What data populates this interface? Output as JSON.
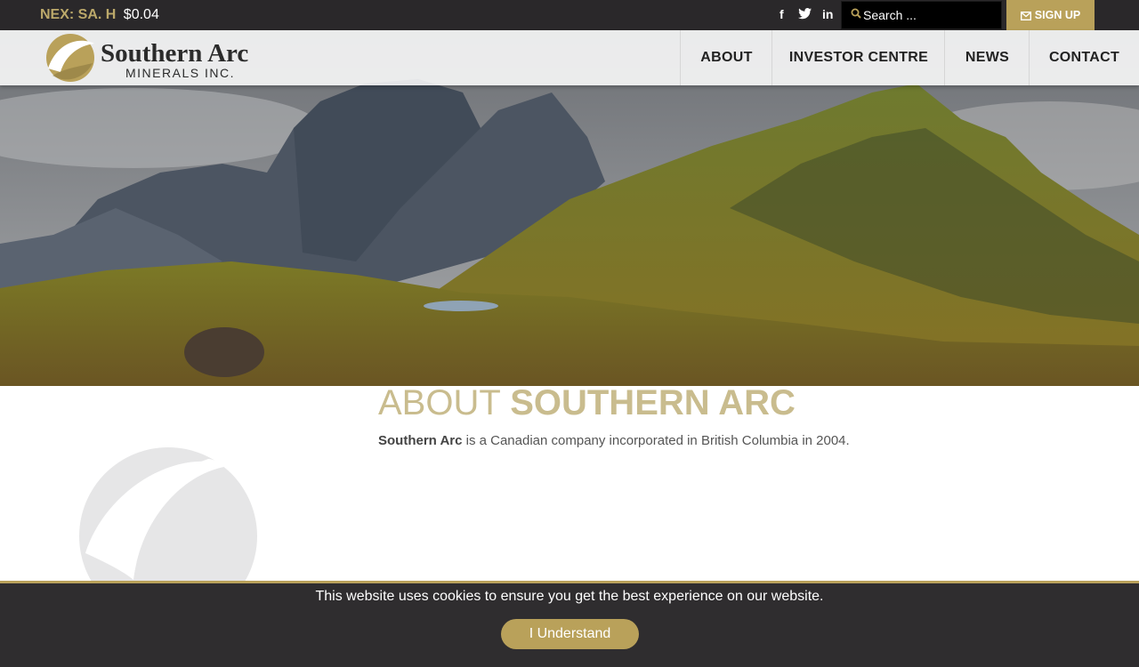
{
  "topbar": {
    "ticker_symbol": "NEX: SA. H",
    "ticker_price": "$0.04",
    "social": {
      "facebook": "f",
      "twitter": "t",
      "linkedin": "in"
    },
    "search_placeholder": "Search ...",
    "signup_label": "SIGN UP"
  },
  "header": {
    "logo_name": "Southern Arc",
    "logo_sub": "MINERALS INC.",
    "nav": [
      "ABOUT",
      "INVESTOR CENTRE",
      "NEWS",
      "CONTACT"
    ]
  },
  "about": {
    "title_light": "ABOUT ",
    "title_strong": "SOUTHERN ARC",
    "text_strong": "Southern Arc",
    "text_rest": " is a Canadian company incorporated in British Columbia in 2004."
  },
  "cookie": {
    "message": "This website uses cookies to ensure you get the best experience on our website.",
    "button_label": "I Understand"
  },
  "colors": {
    "accent": "#b9a15a",
    "topbar": "#2a282a",
    "title": "#c9bc8e",
    "cookie_bg": "#2f2d2f"
  },
  "icons": [
    "facebook-icon",
    "twitter-icon",
    "linkedin-icon",
    "search-icon",
    "mail-icon",
    "logo-mark",
    "watermark-logo"
  ]
}
